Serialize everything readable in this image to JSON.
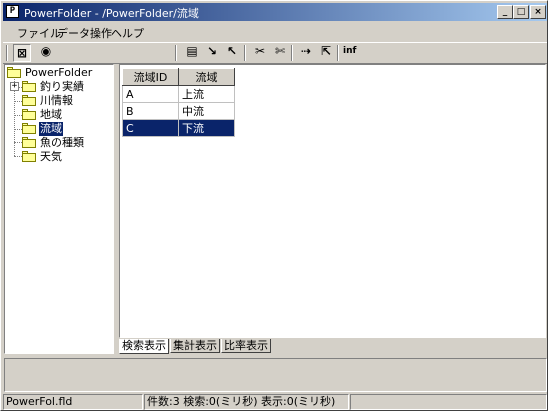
{
  "window": {
    "title": "PowerFolder - /PowerFolder/流域",
    "app_icon": "P",
    "minimize": "_",
    "maximize": "□",
    "close": "×"
  },
  "menu": {
    "items": [
      "ファイル",
      "データ操作",
      "ヘルプ"
    ]
  },
  "toolbar": {
    "buttons": [
      {
        "icon": "chart-view-icon",
        "glyph": "⊠"
      },
      {
        "icon": "eye-icon",
        "glyph": "◉"
      },
      {
        "icon": "copy-icon",
        "glyph": "▤"
      },
      {
        "icon": "pen-icon",
        "glyph": "↘"
      },
      {
        "icon": "eraser-icon",
        "glyph": "↖"
      },
      {
        "icon": "cut-icon",
        "glyph": "✂"
      },
      {
        "icon": "paste-icon",
        "glyph": "✄"
      },
      {
        "icon": "import-icon",
        "glyph": "⇢"
      },
      {
        "icon": "export-icon",
        "glyph": "⇱"
      }
    ],
    "info_label": "inf"
  },
  "tree": {
    "root": "PowerFolder",
    "items": [
      {
        "label": "釣り実績",
        "expandable": true,
        "expander": "+"
      },
      {
        "label": "川情報"
      },
      {
        "label": "地域"
      },
      {
        "label": "流域",
        "selected": true
      },
      {
        "label": "魚の種類"
      },
      {
        "label": "天気"
      }
    ]
  },
  "grid": {
    "columns": [
      "流域ID",
      "流域"
    ],
    "rows": [
      [
        "A",
        "上流"
      ],
      [
        "B",
        "中流"
      ],
      [
        "C",
        "下流"
      ]
    ],
    "selected_row": 2
  },
  "tabs": [
    "検索表示",
    "集計表示",
    "比率表示"
  ],
  "active_tab": 0,
  "statusbar": {
    "file": "PowerFol.fld",
    "info": "件数:3 検索:0(ミリ秒) 表示:0(ミリ秒)"
  }
}
